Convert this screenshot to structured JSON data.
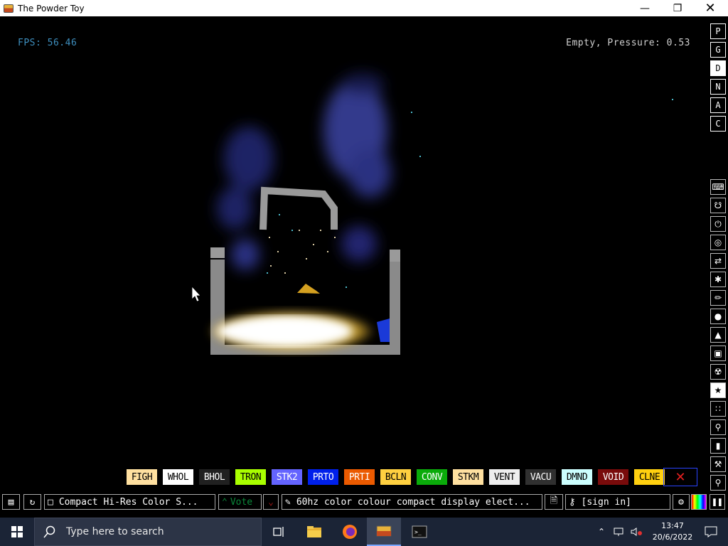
{
  "window": {
    "title": "The Powder Toy"
  },
  "hud": {
    "fps": "FPS: 56.46",
    "status": "Empty, Pressure: 0.53"
  },
  "side_menu": [
    "P",
    "G",
    "D",
    "N",
    "A",
    "C"
  ],
  "tool_icons": [
    "keyboard-icon",
    "plug-icon",
    "power-icon",
    "gauge-icon",
    "arrows-icon",
    "spray-icon",
    "brush-icon",
    "drop-icon",
    "flask-icon",
    "square-icon",
    "radiation-icon",
    "star-icon",
    "dots-icon",
    "bulb-icon",
    "bookmark-icon",
    "hammer-icon",
    "magnifier-icon"
  ],
  "palette": [
    {
      "label": "FIGH",
      "bg": "#ffe0a0",
      "fg": "#000"
    },
    {
      "label": "WHOL",
      "bg": "#ffffff",
      "fg": "#000"
    },
    {
      "label": "BHOL",
      "bg": "#202020",
      "fg": "#fff"
    },
    {
      "label": "TRON",
      "bg": "#a9ff00",
      "fg": "#000"
    },
    {
      "label": "STK2",
      "bg": "#6464ff",
      "fg": "#fff"
    },
    {
      "label": "PRTO",
      "bg": "#0020eb",
      "fg": "#fff"
    },
    {
      "label": "PRTI",
      "bg": "#eb5a00",
      "fg": "#fff"
    },
    {
      "label": "BCLN",
      "bg": "#ffd040",
      "fg": "#000"
    },
    {
      "label": "CONV",
      "bg": "#0aab0a",
      "fg": "#fff"
    },
    {
      "label": "STKM",
      "bg": "#ffe0a0",
      "fg": "#000"
    },
    {
      "label": "VENT",
      "bg": "#eeeeee",
      "fg": "#000"
    },
    {
      "label": "VACU",
      "bg": "#303030",
      "fg": "#fff"
    },
    {
      "label": "DMND",
      "bg": "#ccffff",
      "fg": "#000"
    },
    {
      "label": "VOID",
      "bg": "#790b0b",
      "fg": "#fff"
    },
    {
      "label": "CLNE",
      "bg": "#ffd010",
      "fg": "#000"
    }
  ],
  "bottom": {
    "save_name": "Compact Hi-Res Color S...",
    "vote": "Vote",
    "description": "60hz color colour compact display elect...",
    "signin": "[sign in]"
  },
  "taskbar": {
    "search_placeholder": "Type here to search",
    "time": "13:47",
    "date": "20/6/2022"
  }
}
